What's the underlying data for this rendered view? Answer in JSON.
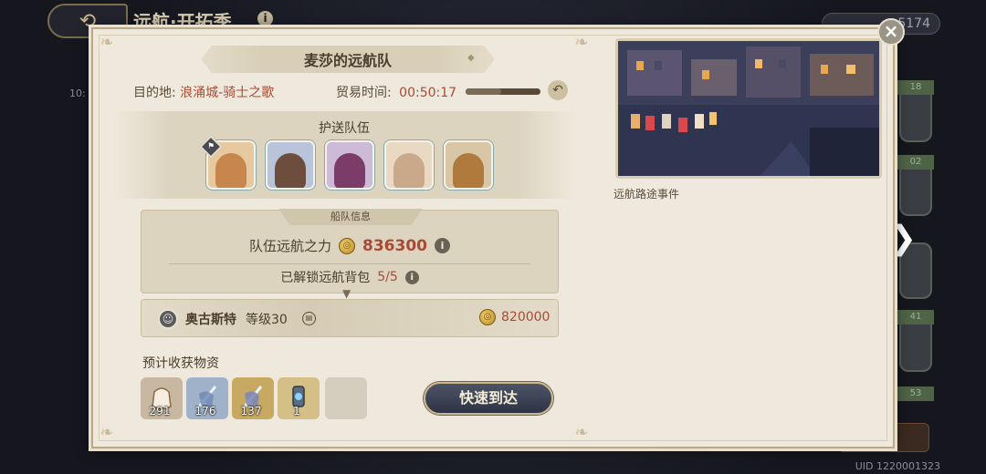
{
  "background": {
    "title": "远航·开拓季",
    "currency": "5174",
    "time_partial": "10:",
    "side_numbers": [
      "18",
      "02",
      "41",
      "53"
    ],
    "uid": "UID 1220001323"
  },
  "panel": {
    "title": "麦莎的远航队",
    "destination_label": "目的地:",
    "destination_value": "浪涌城-骑士之歌",
    "trade_time_label": "贸易时间:",
    "trade_time_value": "00:50:17",
    "trade_progress": 0.48,
    "escort_title": "护送队伍",
    "escort_members": [
      {
        "name": "member-1",
        "leader": true,
        "bg": "#e7c9a0",
        "face": "#c7874c"
      },
      {
        "name": "member-2",
        "leader": false,
        "bg": "#b9c3d9",
        "face": "#6d4d3c"
      },
      {
        "name": "member-3",
        "leader": false,
        "bg": "#cdb9d8",
        "face": "#7b3c6a"
      },
      {
        "name": "member-4",
        "leader": false,
        "bg": "#e9d9c3",
        "face": "#c9a98a"
      },
      {
        "name": "member-5",
        "leader": false,
        "bg": "#d8c6a6",
        "face": "#b07a3d"
      }
    ],
    "fleet": {
      "tab_label": "船队信息",
      "power_label": "队伍远航之力",
      "power_value": "836300",
      "bag_label": "已解锁远航背包",
      "bag_value": "5/5"
    },
    "captain": {
      "name": "奥古斯特",
      "level": "等级30",
      "power_value": "820000"
    },
    "harvest_label": "预计收获物资",
    "items": [
      {
        "icon": "bag-item-icon",
        "count": "291",
        "bg": "#c9b8a1"
      },
      {
        "icon": "sword-blue-item-icon",
        "count": "176",
        "bg": "#9fb2c9"
      },
      {
        "icon": "sword-gold-item-icon",
        "count": "137",
        "bg": "#c8a962"
      },
      {
        "icon": "lantern-item-icon",
        "count": "1",
        "bg": "#d4bf86"
      }
    ],
    "fast_button": "快速到达",
    "scene_caption": "远航路途事件"
  }
}
